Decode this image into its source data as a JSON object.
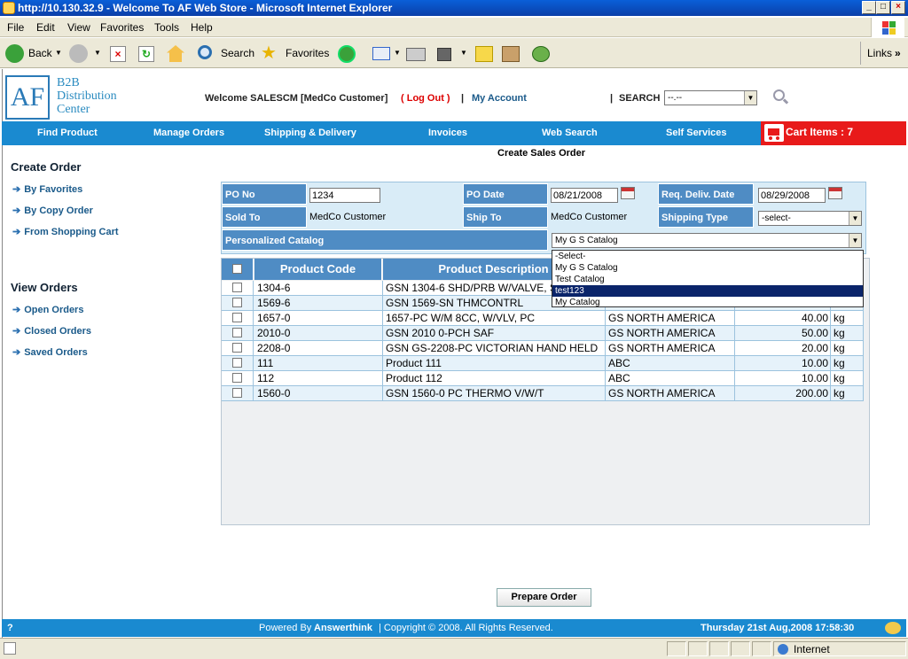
{
  "window": {
    "title": "http://10.130.32.9 - Welcome To AF Web Store - Microsoft Internet Explorer"
  },
  "menu": [
    "File",
    "Edit",
    "View",
    "Favorites",
    "Tools",
    "Help"
  ],
  "toolbar": {
    "back": "Back",
    "search": "Search",
    "favorites": "Favorites",
    "links": "Links"
  },
  "logo": {
    "mark": "AF",
    "line1": "B2B",
    "line2": "Distribution",
    "line3": "Center"
  },
  "header": {
    "welcome": "Welcome SALESCM [MedCo Customer]",
    "logout": "( Log Out )",
    "sep1": "|",
    "account": "My Account",
    "sep2": "|",
    "search_label": "SEARCH",
    "search_value": "--.--"
  },
  "nav": [
    "Find Product",
    "Manage Orders",
    "Shipping & Delivery",
    "Invoices",
    "Web Search",
    "Self Services"
  ],
  "cart": {
    "label": "Cart Items : 7"
  },
  "sidebar": {
    "create_title": "Create Order",
    "create_links": [
      "By Favorites",
      "By Copy Order",
      "From Shopping Cart"
    ],
    "view_title": "View Orders",
    "view_links": [
      "Open Orders",
      "Closed Orders",
      "Saved Orders"
    ]
  },
  "form": {
    "title": "Create Sales Order",
    "po_no_label": "PO No",
    "po_no_value": "1234",
    "po_date_label": "PO Date",
    "po_date_value": "08/21/2008",
    "req_date_label": "Req. Deliv. Date",
    "req_date_value": "08/29/2008",
    "sold_to_label": "Sold To",
    "sold_to_value": "MedCo Customer",
    "ship_to_label": "Ship To",
    "ship_to_value": "MedCo Customer",
    "ship_type_label": "Shipping Type",
    "ship_type_value": "-select-",
    "catalog_label": "Personalized Catalog",
    "catalog_value": "My G S Catalog"
  },
  "catalog_options": [
    "-Select-",
    "My G S Catalog",
    "Test Catalog",
    "test123",
    "My Catalog"
  ],
  "table": {
    "headers": [
      "Product Code",
      "Product Description"
    ],
    "rows": [
      {
        "code": "1304-6",
        "desc": "GSN 1304-6 SHD/PRB W/VALVE, S",
        "vendor": "",
        "qty": "",
        "unit": ""
      },
      {
        "code": "1569-6",
        "desc": "GSN 1569-SN THMCONTRL",
        "vendor": "",
        "qty": "",
        "unit": ""
      },
      {
        "code": "1657-0",
        "desc": "1657-PC W/M 8CC, W/VLV, PC",
        "vendor": "GS NORTH AMERICA",
        "qty": "40.00",
        "unit": "kg"
      },
      {
        "code": "2010-0",
        "desc": "GSN 2010 0-PCH SAF",
        "vendor": "GS NORTH AMERICA",
        "qty": "50.00",
        "unit": "kg"
      },
      {
        "code": "2208-0",
        "desc": "GSN GS-2208-PC VICTORIAN HAND HELD",
        "vendor": "GS NORTH AMERICA",
        "qty": "20.00",
        "unit": "kg"
      },
      {
        "code": "111",
        "desc": "Product 111",
        "vendor": "ABC",
        "qty": "10.00",
        "unit": "kg"
      },
      {
        "code": "112",
        "desc": "Product 112",
        "vendor": "ABC",
        "qty": "10.00",
        "unit": "kg"
      },
      {
        "code": "1560-0",
        "desc": "GSN 1560-0 PC THERMO V/W/T",
        "vendor": "GS NORTH AMERICA",
        "qty": "200.00",
        "unit": "kg"
      }
    ]
  },
  "actions": {
    "prepare": "Prepare Order"
  },
  "footer": {
    "help": "?",
    "powered": "Powered By",
    "brand": "Answerthink",
    "copyright": "| Copyright © 2008. All Rights Reserved.",
    "datetime": "Thursday 21st Aug,2008 17:58:30"
  },
  "status": {
    "zone": "Internet"
  }
}
